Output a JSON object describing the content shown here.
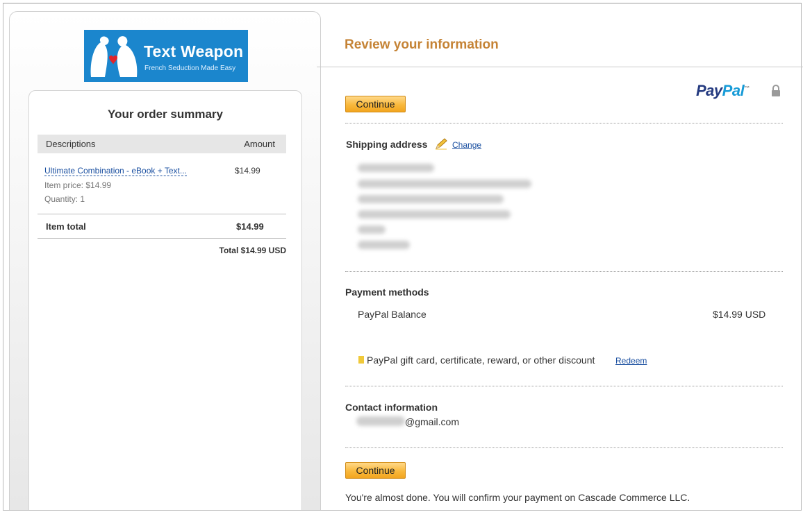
{
  "logo": {
    "title": "Text Weapon",
    "subtitle": "French Seduction Made Easy",
    "color": "#1b86cd"
  },
  "order_summary": {
    "title": "Your order summary",
    "columns": [
      "Descriptions",
      "Amount"
    ],
    "item": {
      "name": "Ultimate Combination - eBook + Text...",
      "amount": "$14.99",
      "price_line": "Item price: $14.99",
      "quantity_line": "Quantity: 1"
    },
    "item_total_label": "Item total",
    "item_total_value": "$14.99",
    "total_line": "Total $14.99 USD"
  },
  "review": {
    "title": "Review your information",
    "title_color": "#c58335",
    "paypal_logo": {
      "pay": "Pay",
      "pal": "Pal",
      "tm": "™"
    },
    "continue_label": "Continue",
    "shipping": {
      "label": "Shipping address",
      "change_label": "Change"
    },
    "payment": {
      "label": "Payment methods",
      "method": "PayPal Balance",
      "amount": "$14.99",
      "currency": "USD",
      "gift_text": "PayPal gift card, certificate, reward, or other discount",
      "redeem_label": "Redeem"
    },
    "contact": {
      "label": "Contact information",
      "email_visible": "@gmail.com"
    },
    "footer_text": "You're almost done. You will confirm your payment on Cascade Commerce LLC."
  },
  "colors": {
    "button": "#f9b83c",
    "link": "#1a4fa0"
  }
}
